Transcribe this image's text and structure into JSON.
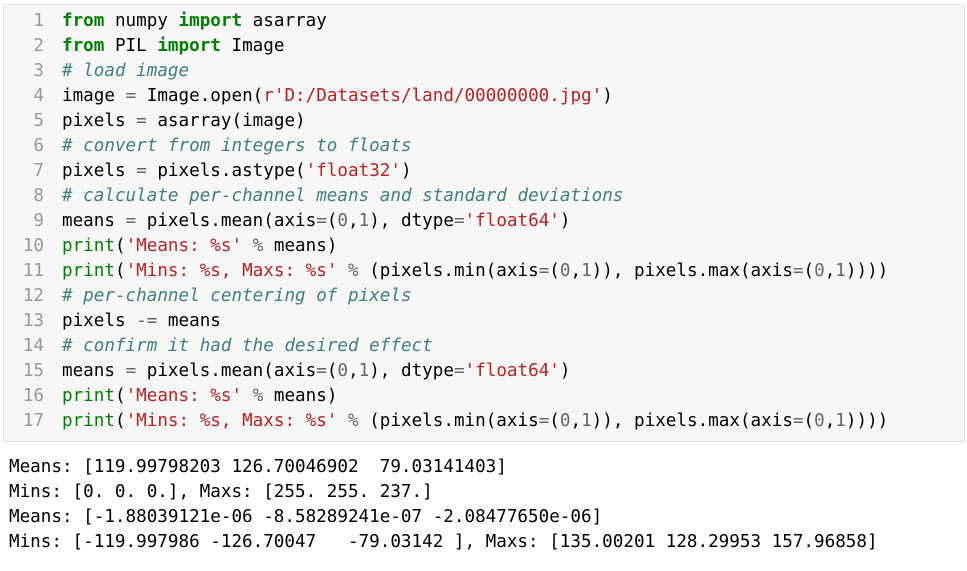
{
  "code_cell": {
    "lines": [
      {
        "num": "1",
        "code": "from numpy import asarray"
      },
      {
        "num": "2",
        "code": "from PIL import Image"
      },
      {
        "num": "3",
        "code": "# load image"
      },
      {
        "num": "4",
        "code": "image = Image.open(r'D:/Datasets/land/00000000.jpg')"
      },
      {
        "num": "5",
        "code": "pixels = asarray(image)"
      },
      {
        "num": "6",
        "code": "# convert from integers to floats"
      },
      {
        "num": "7",
        "code": "pixels = pixels.astype('float32')"
      },
      {
        "num": "8",
        "code": "# calculate per-channel means and standard deviations"
      },
      {
        "num": "9",
        "code": "means = pixels.mean(axis=(0,1), dtype='float64')"
      },
      {
        "num": "10",
        "code": "print('Means: %s' % means)"
      },
      {
        "num": "11",
        "code": "print('Mins: %s, Maxs: %s' % (pixels.min(axis=(0,1)), pixels.max(axis=(0,1))))"
      },
      {
        "num": "12",
        "code": "# per-channel centering of pixels"
      },
      {
        "num": "13",
        "code": "pixels -= means"
      },
      {
        "num": "14",
        "code": "# confirm it had the desired effect"
      },
      {
        "num": "15",
        "code": "means = pixels.mean(axis=(0,1), dtype='float64')"
      },
      {
        "num": "16",
        "code": "print('Means: %s' % means)"
      },
      {
        "num": "17",
        "code": "print('Mins: %s, Maxs: %s' % (pixels.min(axis=(0,1)), pixels.max(axis=(0,1))))"
      }
    ]
  },
  "output": {
    "lines": [
      "Means: [119.99798203 126.70046902  79.03141403]",
      "Mins: [0. 0. 0.], Maxs: [255. 255. 237.]",
      "Means: [-1.88039121e-06 -8.58289241e-07 -2.08477650e-06]",
      "Mins: [-119.997986 -126.70047   -79.03142 ], Maxs: [135.00201 128.29953 157.96858]"
    ]
  },
  "colors": {
    "keyword": "#008000",
    "comment": "#408080",
    "string": "#ba2121",
    "cell_background": "#f7f7f7"
  }
}
